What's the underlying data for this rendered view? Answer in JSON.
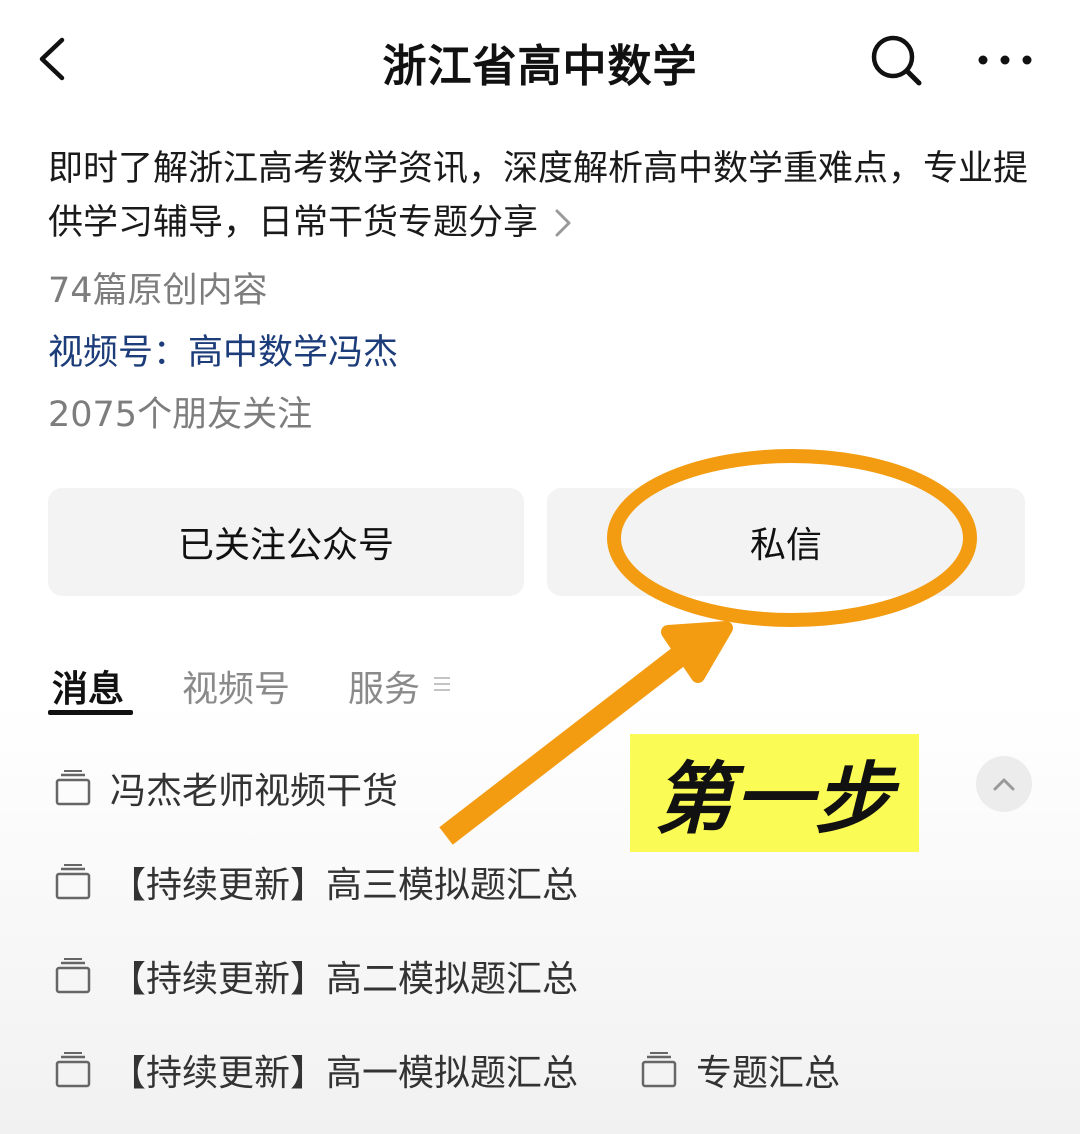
{
  "header": {
    "title": "浙江省高中数学",
    "back_icon": "chevron-left-icon",
    "search_icon": "search-icon",
    "more_icon": "more-horizontal-icon"
  },
  "profile": {
    "description": "即时了解浙江高考数学资讯，深度解析高中数学重难点，专业提供学习辅导，日常干货专题分享",
    "original_count": "74篇原创内容",
    "channel": "视频号：高中数学冯杰",
    "friends_following": "2075个朋友关注"
  },
  "buttons": {
    "follow_label": "已关注公众号",
    "message_label": "私信"
  },
  "tabs": [
    {
      "label": "消息",
      "active": true
    },
    {
      "label": "视频号",
      "active": false
    },
    {
      "label": "服务",
      "active": false
    }
  ],
  "list": [
    "冯杰老师视频干货",
    "【持续更新】高三模拟题汇总",
    "【持续更新】高二模拟题汇总",
    "【持续更新】高一模拟题汇总",
    "专题汇总"
  ],
  "annotation": {
    "step_label": "第一步",
    "highlight_color": "#f39c12",
    "label_bg": "#fbfb55"
  },
  "colors": {
    "link": "#1d3d7a",
    "muted": "#7d7d7d",
    "button_bg": "#f3f3f3"
  }
}
